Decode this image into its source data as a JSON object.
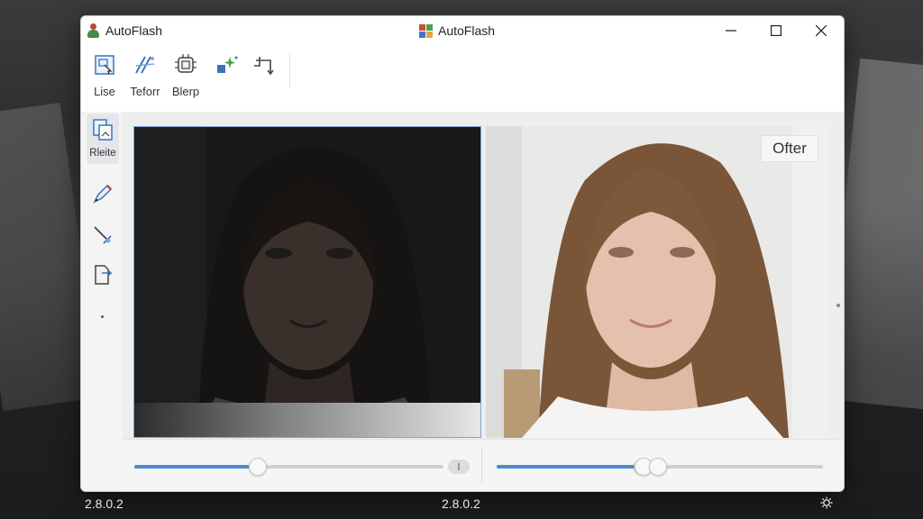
{
  "window": {
    "title_left": "AutoFlash",
    "title_center": "AutoFlash",
    "controls": [
      "minimize",
      "maximize",
      "close"
    ]
  },
  "toolbar": {
    "items": [
      {
        "label": "Lise",
        "icon": "image-select-icon"
      },
      {
        "label": "Teforr",
        "icon": "magic-wand-icon"
      },
      {
        "label": "Blerp",
        "icon": "chip-filter-icon"
      },
      {
        "label": "",
        "icon": "sparkle-enhance-icon"
      },
      {
        "label": "",
        "icon": "crop-transform-icon"
      }
    ]
  },
  "sidebar": {
    "items": [
      {
        "label": "Rleite",
        "icon": "layers-copy-icon",
        "active": true
      },
      {
        "label": "",
        "icon": "pen-tool-icon"
      },
      {
        "label": "",
        "icon": "brush-tool-icon"
      },
      {
        "label": "",
        "icon": "document-export-icon"
      }
    ]
  },
  "preview": {
    "after_label": "Ofter"
  },
  "sliders": {
    "left_level": 0.4,
    "right_level": 0.45
  },
  "status": {
    "version_left": "2.8.0.2",
    "version_center": "2.8.0.2"
  },
  "colors": {
    "accent": "#4a8ad3",
    "selection_border": "#7ea3d6"
  }
}
